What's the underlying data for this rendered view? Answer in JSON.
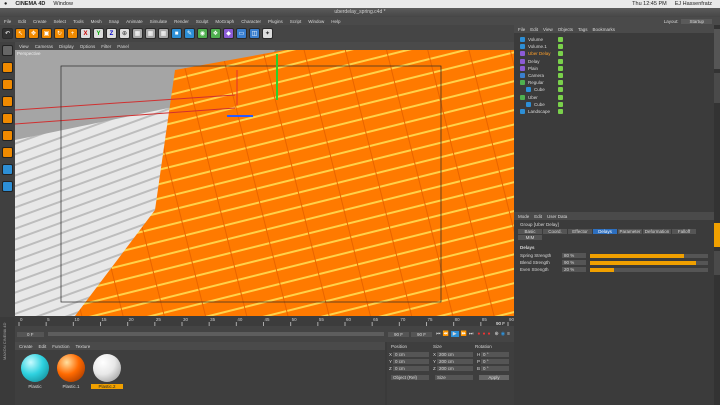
{
  "os_menu": {
    "app": "CINEMA 4D",
    "window": "Window",
    "time": "Thu 12:45 PM",
    "user": "EJ Hassenfratz"
  },
  "title": "uberdelay_spring.c4d *",
  "menubar": [
    "File",
    "Edit",
    "Create",
    "Select",
    "Tools",
    "Mesh",
    "Snap",
    "Animate",
    "Simulate",
    "Render",
    "Sculpt",
    "MoGraph",
    "Character",
    "Plugins",
    "Script",
    "Window",
    "Help"
  ],
  "layout": {
    "label": "Layout:",
    "value": "Startup"
  },
  "viewport_menu": [
    "View",
    "Cameras",
    "Display",
    "Options",
    "Filter",
    "Panel"
  ],
  "viewport_label": "Perspective",
  "object_manager": {
    "menu": [
      "File",
      "Edit",
      "View",
      "Objects",
      "Tags",
      "Bookmarks"
    ],
    "objects": [
      "Volume",
      "Volume.1",
      "Uber Delay",
      "Delay",
      "Plain",
      "Camera",
      "Regular",
      "Cube",
      "Uber",
      "Cube",
      "Landscape"
    ]
  },
  "attribute_manager": {
    "menu": [
      "Mode",
      "Edit",
      "User Data"
    ],
    "group_title": "Group [Uber Delay]",
    "tabs": [
      "Basic",
      "Coord.",
      "Effector",
      "Delays",
      "Parameter",
      "Deformation",
      "Falloff",
      "MIM"
    ],
    "active_tab": "Delays",
    "section": "Delays",
    "params": [
      {
        "label": "Spring Strength",
        "value": "80 %",
        "fill": 0.8
      },
      {
        "label": "Blend Strength",
        "value": "90 %",
        "fill": 0.9
      },
      {
        "label": "Even Strength",
        "value": "20 %",
        "fill": 0.2
      }
    ]
  },
  "timeline": {
    "ticks": [
      "0",
      "5",
      "10",
      "15",
      "20",
      "25",
      "30",
      "35",
      "40",
      "45",
      "50",
      "55",
      "60",
      "65",
      "70",
      "75",
      "80",
      "85",
      "90"
    ],
    "current": "90 F",
    "start": "0 F",
    "end": "90 F",
    "end2": "90 F"
  },
  "material_menu": [
    "Create",
    "Edit",
    "Function",
    "Texture"
  ],
  "materials": [
    {
      "name": "Plastic",
      "color": "#2fd2e0"
    },
    {
      "name": "Plastic.1",
      "color": "#ff6a00"
    },
    {
      "name": "Plastic.2",
      "color": "#f2f2f2"
    }
  ],
  "coordinates": {
    "headers": [
      "Position",
      "Size",
      "Rotation"
    ],
    "rows": [
      {
        "axis": "X",
        "pos": "0 cm",
        "size": "200 cm",
        "rot": "H",
        "rotval": "0 °"
      },
      {
        "axis": "Y",
        "pos": "0 cm",
        "size": "200 cm",
        "rot": "P",
        "rotval": "0 °"
      },
      {
        "axis": "Z",
        "pos": "0 cm",
        "size": "200 cm",
        "rot": "B",
        "rotval": "0 °"
      }
    ],
    "mode": "Object (Rel)",
    "size_mode": "Size",
    "apply": "Apply"
  },
  "maxon": "MAXON CINEMA 4D"
}
